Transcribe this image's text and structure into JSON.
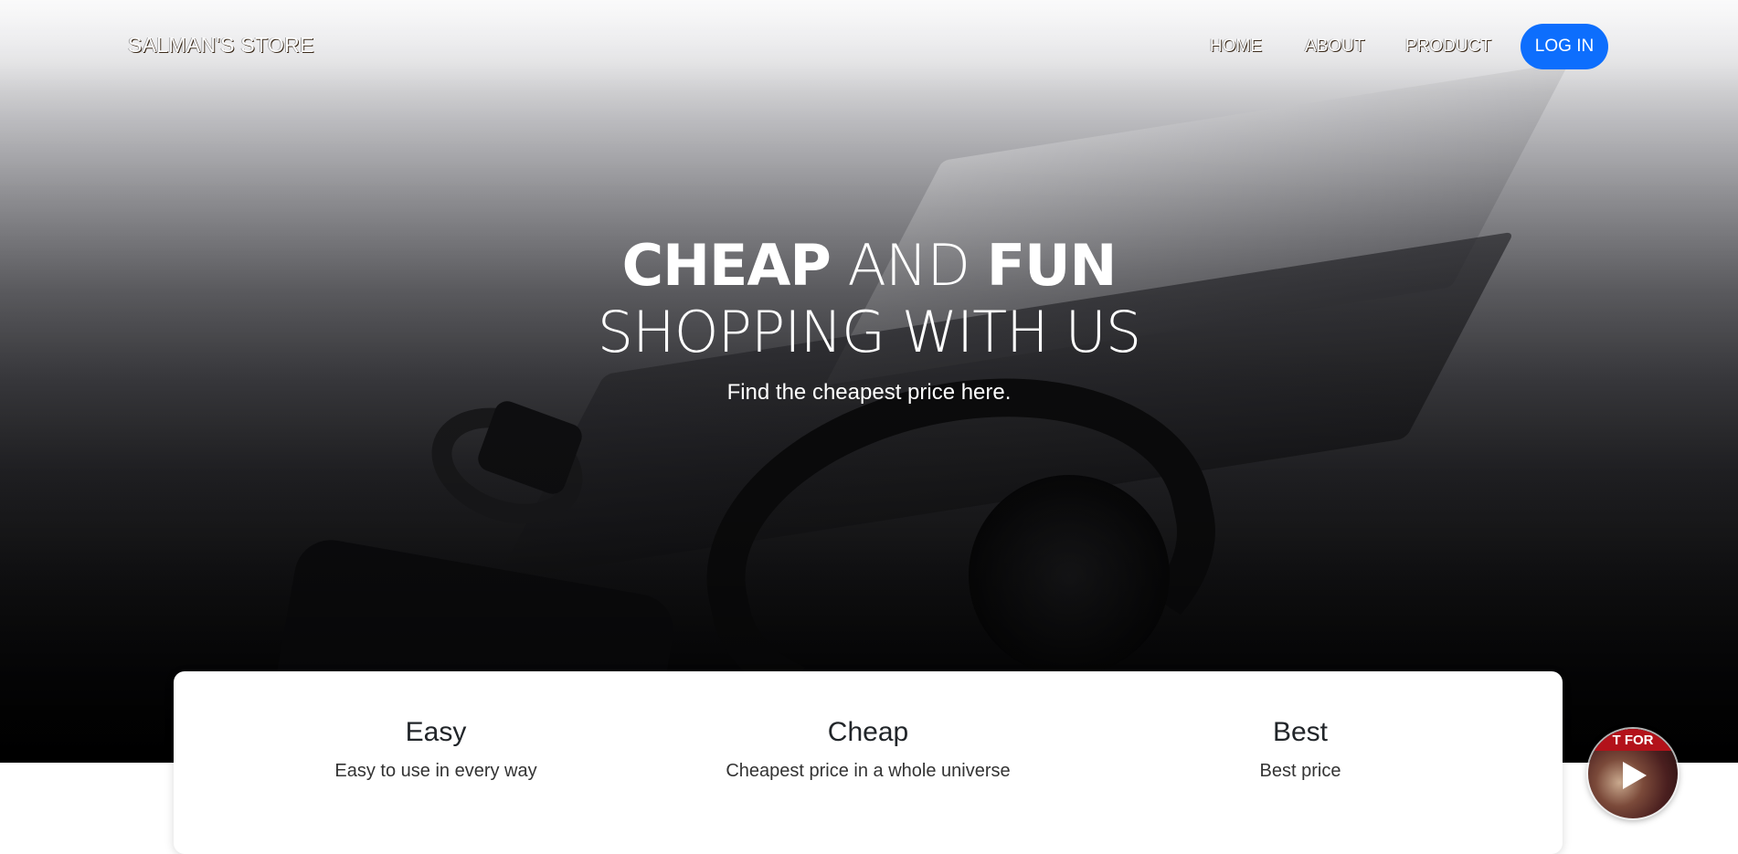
{
  "navbar": {
    "brand": "SALMAN'S STORE",
    "links": [
      "HOME",
      "ABOUT",
      "PRODUCT"
    ],
    "login_label": "LOG IN"
  },
  "hero": {
    "line1_bold_a": "CHEAP",
    "line1_light": " AND ",
    "line1_bold_b": "FUN",
    "line2": "SHOPPING WITH US",
    "subtitle": "Find the cheapest price here."
  },
  "features": [
    {
      "title": "Easy",
      "text": "Easy to use in every way"
    },
    {
      "title": "Cheap",
      "text": "Cheapest price in a whole universe"
    },
    {
      "title": "Best",
      "text": "Best price"
    }
  ],
  "video_bubble": {
    "banner_text": "T FOR"
  },
  "colors": {
    "primary": "#0d6efd",
    "text_dark": "#212529"
  }
}
